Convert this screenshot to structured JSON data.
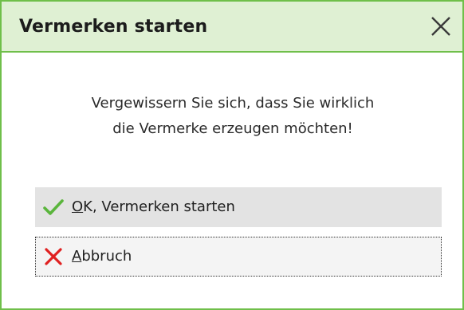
{
  "dialog": {
    "title": "Vermerken starten",
    "close_icon": "close-icon",
    "message_line1": "Vergewissern Sie sich, dass Sie wirklich",
    "message_line2": "die Vermerke erzeugen möchten!",
    "ok_button": {
      "mnemonic": "O",
      "label_rest": "K, Vermerken starten",
      "icon": "checkmark-icon"
    },
    "cancel_button": {
      "mnemonic": "A",
      "label_rest": "bbruch",
      "icon": "red-x-icon"
    }
  },
  "colors": {
    "border": "#6fbf4a",
    "titlebar_bg": "#dff0d3",
    "check": "#5ab53c",
    "cross": "#e02020"
  }
}
